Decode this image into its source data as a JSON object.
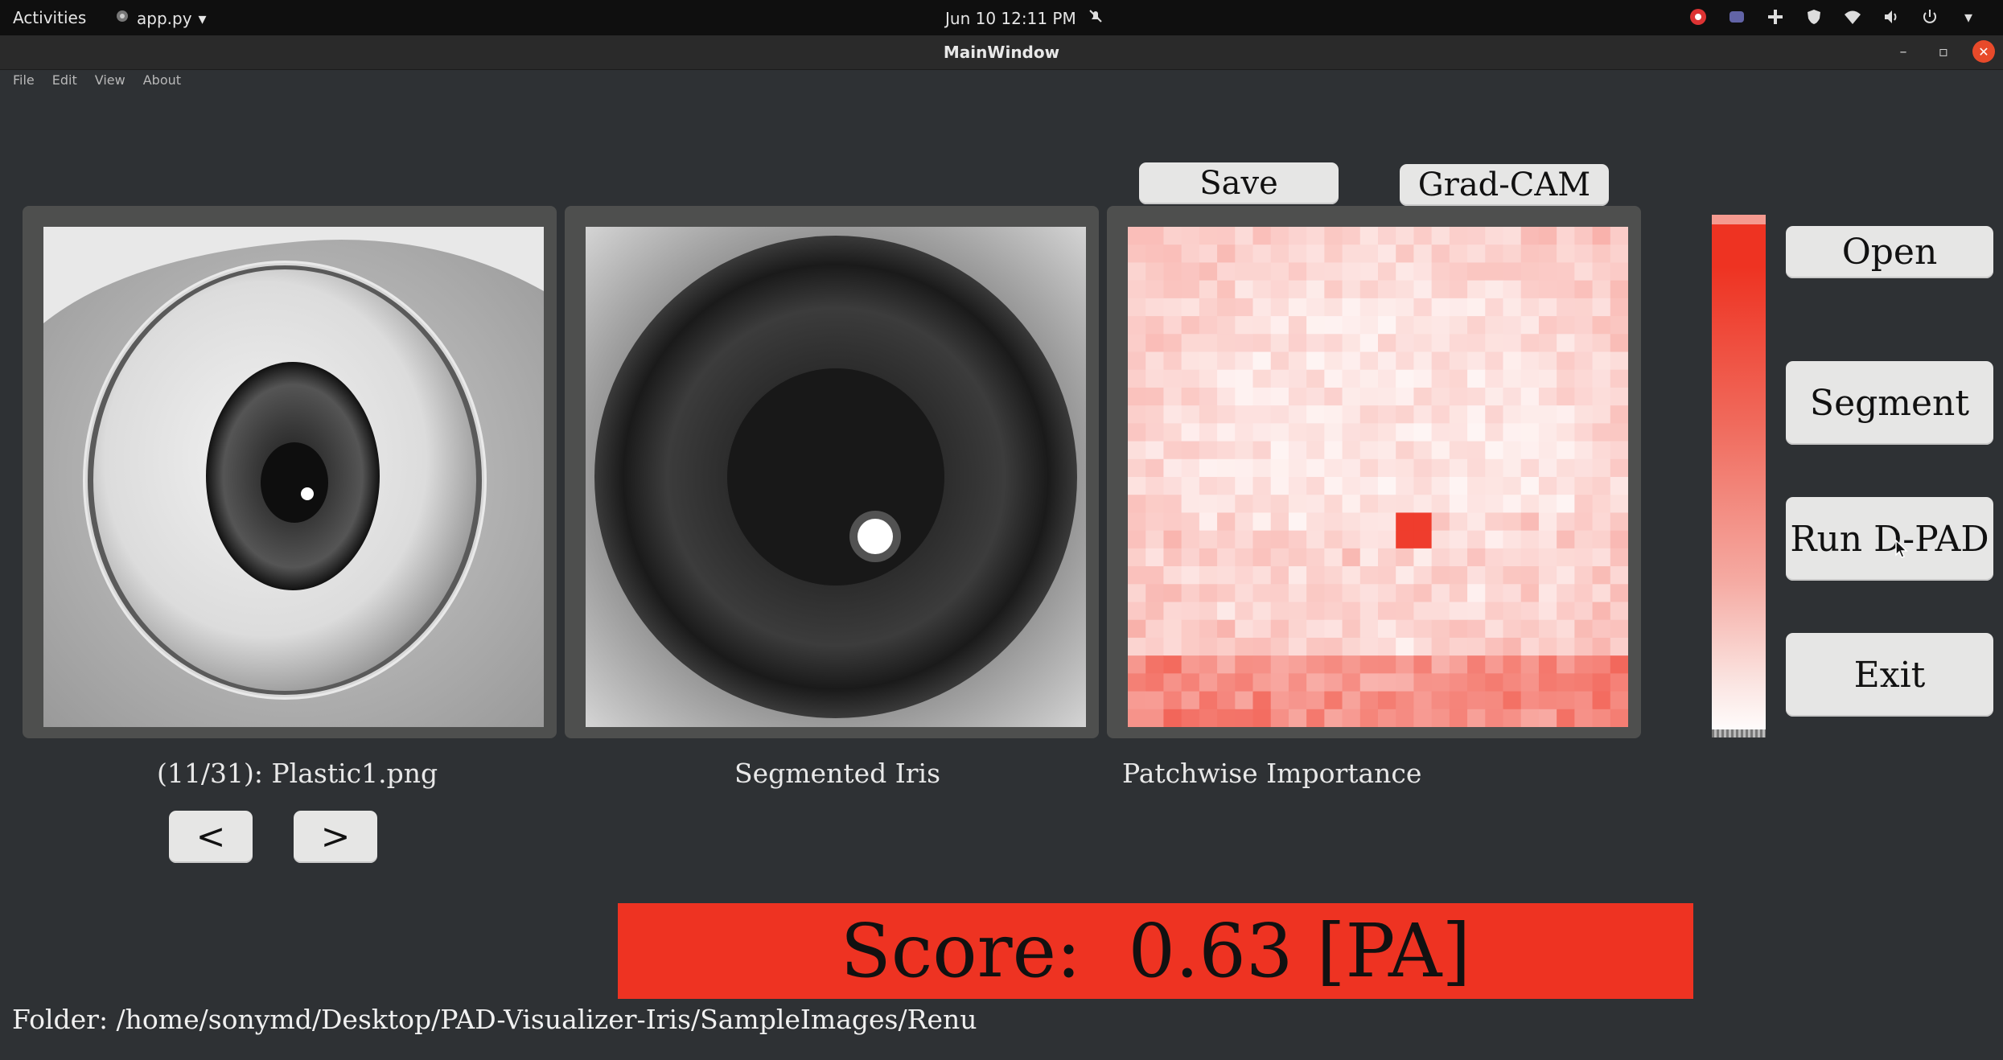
{
  "topbar": {
    "activities": "Activities",
    "app_name": "app.py",
    "clock": "Jun 10  12:11 PM"
  },
  "window": {
    "title": "MainWindow"
  },
  "menu": {
    "items": [
      "File",
      "Edit",
      "View",
      "About"
    ]
  },
  "panels": {
    "original_caption": "(11/31): Plastic1.png",
    "segmented_caption": "Segmented Iris",
    "importance_caption": "Patchwise Importance"
  },
  "buttons": {
    "save": "Save",
    "gradcam": "Grad-CAM",
    "open": "Open",
    "segment": "Segment",
    "run": "Run D-PAD",
    "exit": "Exit",
    "prev": "<",
    "next": ">"
  },
  "score": {
    "text": "Score:  0.63 [PA]",
    "color": "#ee3322"
  },
  "folder": {
    "text": "Folder: /home/sonymd/Desktop/PAD-Visualizer-Iris/SampleImages/Renu"
  },
  "colors": {
    "accent": "#ee3322",
    "background": "#2e3134",
    "button": "#e6e6e5"
  }
}
